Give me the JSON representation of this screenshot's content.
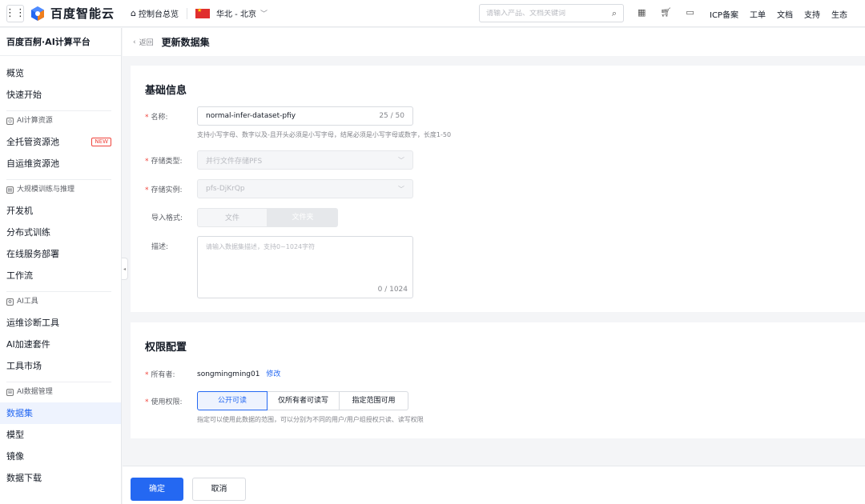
{
  "topbar": {
    "brand": "百度智能云",
    "console_home": "控制台总览",
    "region": "华北 - 北京",
    "search_placeholder": "请输入产品、文档关键词",
    "links": [
      "ICP备案",
      "工单",
      "文档",
      "支持",
      "生态"
    ],
    "colors": {
      "brand_blue": "#2468f2",
      "flag_red": "#e02e2e"
    }
  },
  "sidebar": {
    "title": "百度百舸·AI计算平台",
    "top_items": [
      "概览",
      "快速开始"
    ],
    "groups": [
      {
        "label": "AI计算资源",
        "items": [
          {
            "label": "全托管资源池",
            "badge": "NEW"
          },
          {
            "label": "自运维资源池"
          }
        ]
      },
      {
        "label": "大规模训练与推理",
        "items": [
          {
            "label": "开发机"
          },
          {
            "label": "分布式训练"
          },
          {
            "label": "在线服务部署"
          },
          {
            "label": "工作流"
          }
        ]
      },
      {
        "label": "AI工具",
        "items": [
          {
            "label": "运维诊断工具"
          },
          {
            "label": "AI加速套件"
          },
          {
            "label": "工具市场"
          }
        ]
      },
      {
        "label": "AI数据管理",
        "items": [
          {
            "label": "数据集",
            "active": true
          },
          {
            "label": "模型"
          },
          {
            "label": "镜像"
          },
          {
            "label": "数据下载"
          }
        ]
      }
    ]
  },
  "header": {
    "back": "返回",
    "title": "更新数据集"
  },
  "basic": {
    "title": "基础信息",
    "name_label": "名称:",
    "name_value": "normal-infer-dataset-pfiy",
    "name_count": "25 / 50",
    "name_hint": "支持小写字母、数字以及-且开头必须是小写字母，结尾必须是小写字母或数字，长度1-50",
    "storage_type_label": "存储类型:",
    "storage_type_value": "并行文件存储PFS",
    "storage_instance_label": "存储实例:",
    "storage_instance_value": "pfs-DjKrQp",
    "import_label": "导入格式:",
    "import_options": [
      "文件",
      "文件夹"
    ],
    "desc_label": "描述:",
    "desc_placeholder": "请输入数据集描述，支持0~1024字符",
    "desc_count": "0 / 1024"
  },
  "permission": {
    "title": "权限配置",
    "owner_label": "所有者:",
    "owner_value": "songmingming01",
    "owner_edit": "修改",
    "perm_label": "使用权限:",
    "perm_options": [
      "公开可读",
      "仅所有者可读写",
      "指定范围可用"
    ],
    "perm_hint": "指定可以使用此数据的范围，可以分别为不同的用户/用户组授权只读、读写权限"
  },
  "footer": {
    "confirm": "确定",
    "cancel": "取消"
  }
}
